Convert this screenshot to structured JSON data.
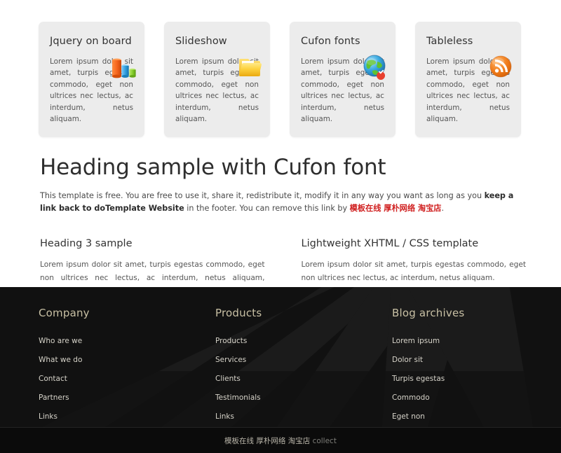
{
  "features": [
    {
      "title": "Jquery on board",
      "body": "Lorem ipsum dolor sit amet, turpis egestas commodo, eget non ultrices nec lectus, ac interdum, netus aliquam.",
      "icon": "bar-chart-icon"
    },
    {
      "title": "Slideshow",
      "body": "Lorem ipsum dolor sit amet, turpis egestas commodo, eget non ultrices nec lectus, ac interdum, netus aliquam.",
      "icon": "folder-icon"
    },
    {
      "title": "Cufon fonts",
      "body": "Lorem ipsum dolor sit amet, turpis egestas commodo, eget non ultrices nec lectus, ac interdum, netus aliquam.",
      "icon": "globe-icon"
    },
    {
      "title": "Tableless",
      "body": "Lorem ipsum dolor sit amet, turpis egestas commodo, eget non ultrices nec lectus, ac interdum, netus aliquam.",
      "icon": "rss-icon"
    }
  ],
  "intro": {
    "heading": "Heading sample with Cufon font",
    "text_before_bold": "This template is free. You are free to use it, share it, redistribute it, modify it in any way you want as long as you ",
    "bold_text": "keep a link back to doTemplate Website",
    "text_after_bold": " in the footer. You can remove this link by ",
    "link_text": "模板在线 厚朴网络 淘宝店",
    "text_end": "."
  },
  "columns": [
    {
      "heading": "Heading 3 sample",
      "body": "Lorem ipsum dolor sit amet, turpis egestas commodo, eget non ultrices nec lectus, ac interdum, netus aliquam, vulputate vel reiciendis risus."
    },
    {
      "heading": "Lightweight XHTML / CSS template",
      "body": "Lorem ipsum dolor sit amet, turpis egestas commodo, eget non ultrices nec lectus, ac interdum, netus aliquam."
    }
  ],
  "footer": {
    "columns": [
      {
        "title": "Company",
        "links": [
          "Who are we",
          "What we do",
          "Contact",
          "Partners",
          "Links"
        ]
      },
      {
        "title": "Products",
        "links": [
          "Products",
          "Services",
          "Clients",
          "Testimonials",
          "Links"
        ]
      },
      {
        "title": "Blog archives",
        "links": [
          "Lorem ipsum",
          "Dolor sit",
          "Turpis egestas",
          "Commodo",
          "Eget non"
        ]
      }
    ]
  },
  "bottom_bar": {
    "link_text": "模板在线 厚朴网络 淘宝店",
    "suffix": "collect"
  },
  "colors": {
    "page_background": "#ffffff",
    "card_background": "#ececec",
    "footer_background": "#121212",
    "bottom_bar_background": "#0b0b0b",
    "footer_title": "#c8c0a4",
    "footer_link": "#d6d3c9",
    "accent_red": "#d02020",
    "body_text": "#555555",
    "heading_text": "#2e2e2e"
  }
}
